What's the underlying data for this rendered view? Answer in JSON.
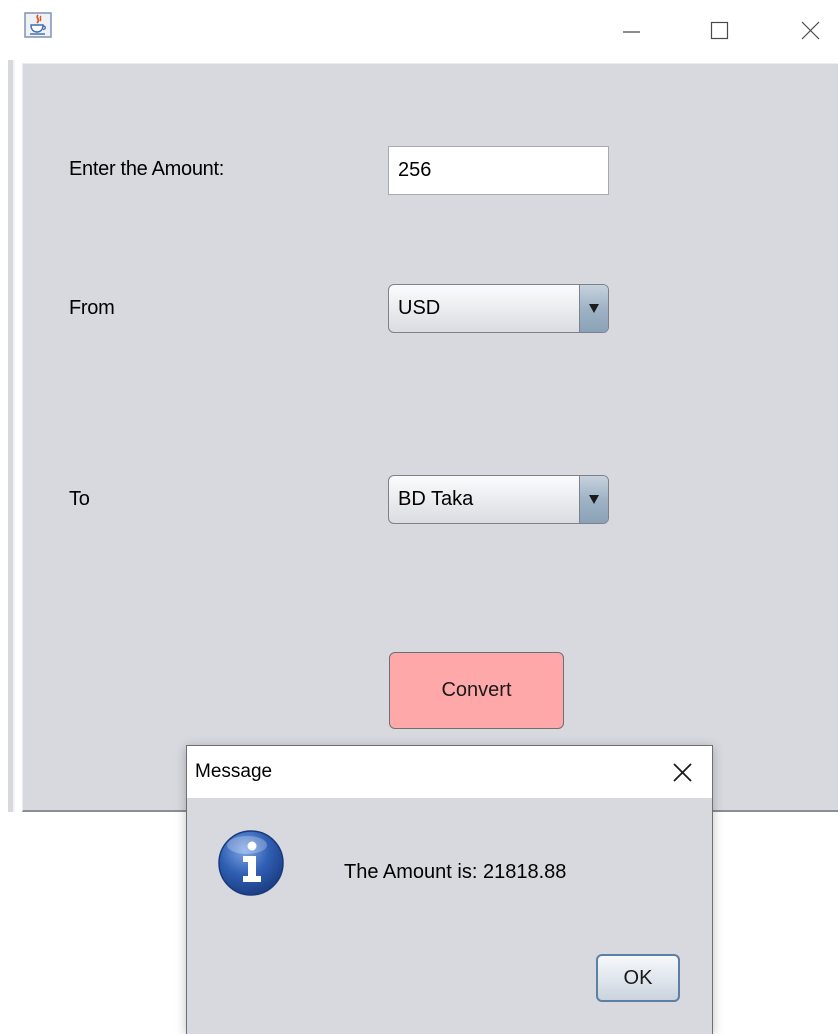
{
  "window": {
    "app_icon": "java-coffee-cup-icon",
    "controls": {
      "minimize_icon": "minimize-icon",
      "maximize_icon": "maximize-icon",
      "close_icon": "close-icon"
    }
  },
  "form": {
    "amount_label": "Enter the Amount:",
    "amount_value": "256",
    "from_label": "From",
    "from_selected": "USD",
    "to_label": "To",
    "to_selected": "BD Taka",
    "convert_label": "Convert"
  },
  "dialog": {
    "title": "Message",
    "icon": "information-icon",
    "message": "The Amount is: 21818.88",
    "ok_label": "OK"
  },
  "colors": {
    "panel_background": "#d7d9df",
    "convert_button": "#ffa8aa",
    "info_icon_blue": "#2f5fb3"
  }
}
